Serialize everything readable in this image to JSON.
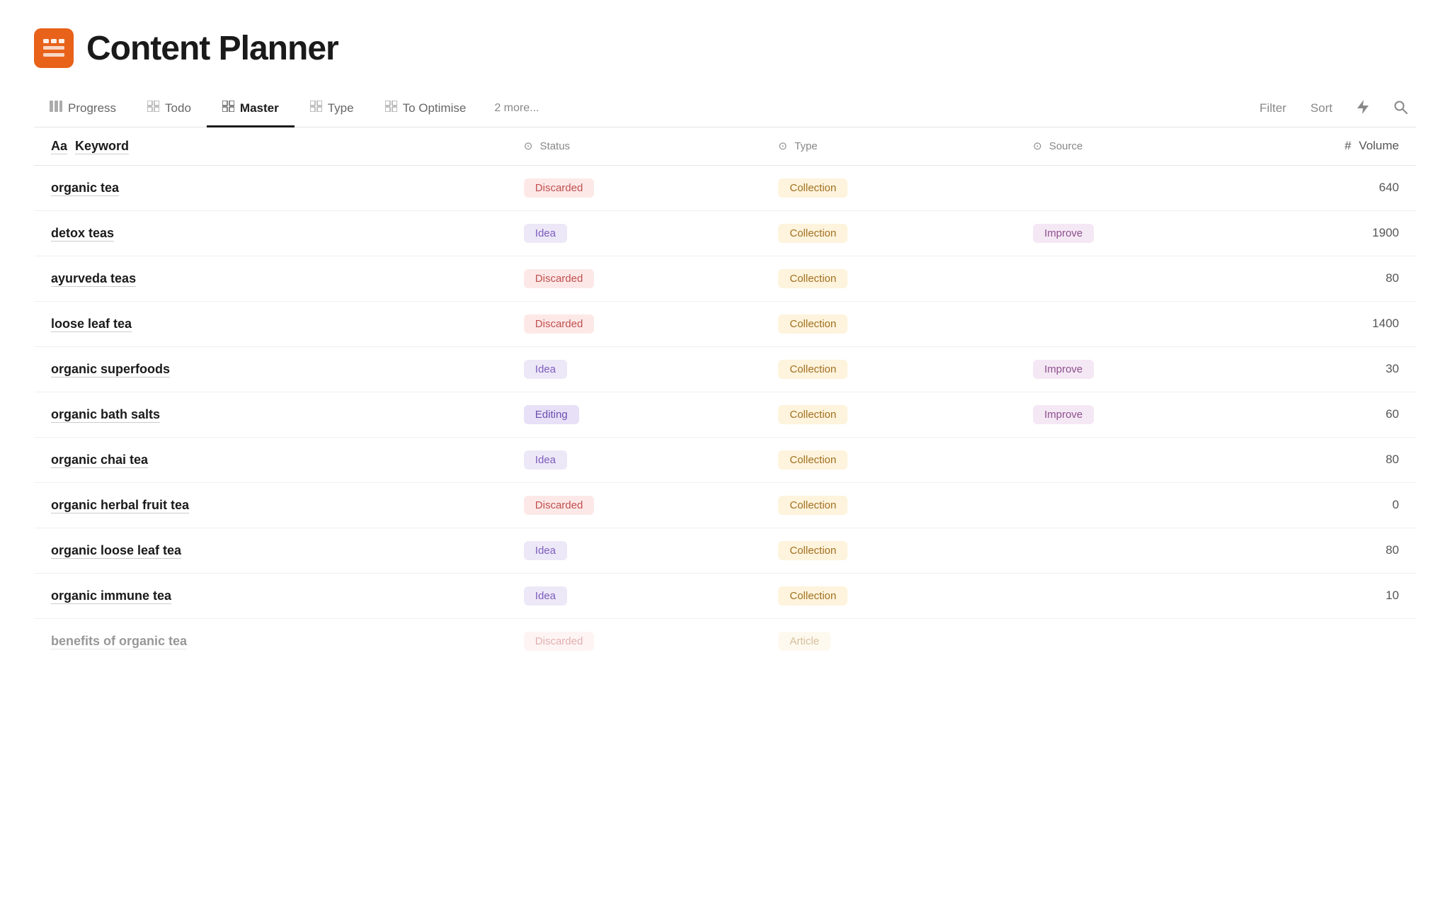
{
  "header": {
    "icon_label": "app-icon",
    "title": "Content Planner"
  },
  "tabs": {
    "items": [
      {
        "id": "progress",
        "label": "Progress",
        "active": false
      },
      {
        "id": "todo",
        "label": "Todo",
        "active": false
      },
      {
        "id": "master",
        "label": "Master",
        "active": true
      },
      {
        "id": "type",
        "label": "Type",
        "active": false
      },
      {
        "id": "to-optimise",
        "label": "To Optimise",
        "active": false
      },
      {
        "id": "more",
        "label": "2 more...",
        "active": false
      }
    ],
    "toolbar": {
      "filter": "Filter",
      "sort": "Sort",
      "lightning": "⚡",
      "search": "🔍"
    }
  },
  "table": {
    "columns": [
      {
        "id": "keyword",
        "label": "Keyword",
        "prefix": "Aa"
      },
      {
        "id": "status",
        "label": "Status",
        "prefix": "⊙"
      },
      {
        "id": "type",
        "label": "Type",
        "prefix": "⊙"
      },
      {
        "id": "source",
        "label": "Source",
        "prefix": "⊙"
      },
      {
        "id": "volume",
        "label": "Volume",
        "prefix": "#"
      }
    ],
    "rows": [
      {
        "keyword": "organic tea",
        "status": "Discarded",
        "status_type": "discarded",
        "type": "Collection",
        "type_style": "collection",
        "source": "",
        "source_style": "",
        "volume": "640"
      },
      {
        "keyword": "detox teas",
        "status": "Idea",
        "status_type": "idea",
        "type": "Collection",
        "type_style": "collection",
        "source": "Improve",
        "source_style": "improve",
        "volume": "1900"
      },
      {
        "keyword": "ayurveda teas",
        "status": "Discarded",
        "status_type": "discarded",
        "type": "Collection",
        "type_style": "collection",
        "source": "",
        "source_style": "",
        "volume": "80"
      },
      {
        "keyword": "loose leaf tea",
        "status": "Discarded",
        "status_type": "discarded",
        "type": "Collection",
        "type_style": "collection",
        "source": "",
        "source_style": "",
        "volume": "1400"
      },
      {
        "keyword": "organic superfoods",
        "status": "Idea",
        "status_type": "idea",
        "type": "Collection",
        "type_style": "collection",
        "source": "Improve",
        "source_style": "improve",
        "volume": "30"
      },
      {
        "keyword": "organic bath salts",
        "status": "Editing",
        "status_type": "editing",
        "type": "Collection",
        "type_style": "collection",
        "source": "Improve",
        "source_style": "improve",
        "volume": "60"
      },
      {
        "keyword": "organic chai tea",
        "status": "Idea",
        "status_type": "idea",
        "type": "Collection",
        "type_style": "collection",
        "source": "",
        "source_style": "",
        "volume": "80"
      },
      {
        "keyword": "organic herbal fruit tea",
        "status": "Discarded",
        "status_type": "discarded",
        "type": "Collection",
        "type_style": "collection",
        "source": "",
        "source_style": "",
        "volume": "0"
      },
      {
        "keyword": "organic loose leaf tea",
        "status": "Idea",
        "status_type": "idea",
        "type": "Collection",
        "type_style": "collection",
        "source": "",
        "source_style": "",
        "volume": "80"
      },
      {
        "keyword": "organic immune tea",
        "status": "Idea",
        "status_type": "idea",
        "type": "Collection",
        "type_style": "collection",
        "source": "",
        "source_style": "",
        "volume": "10"
      },
      {
        "keyword": "benefits of organic tea",
        "status": "Discarded",
        "status_type": "discarded",
        "type": "Article",
        "type_style": "article",
        "source": "",
        "source_style": "",
        "volume": "",
        "faded": true
      }
    ]
  }
}
